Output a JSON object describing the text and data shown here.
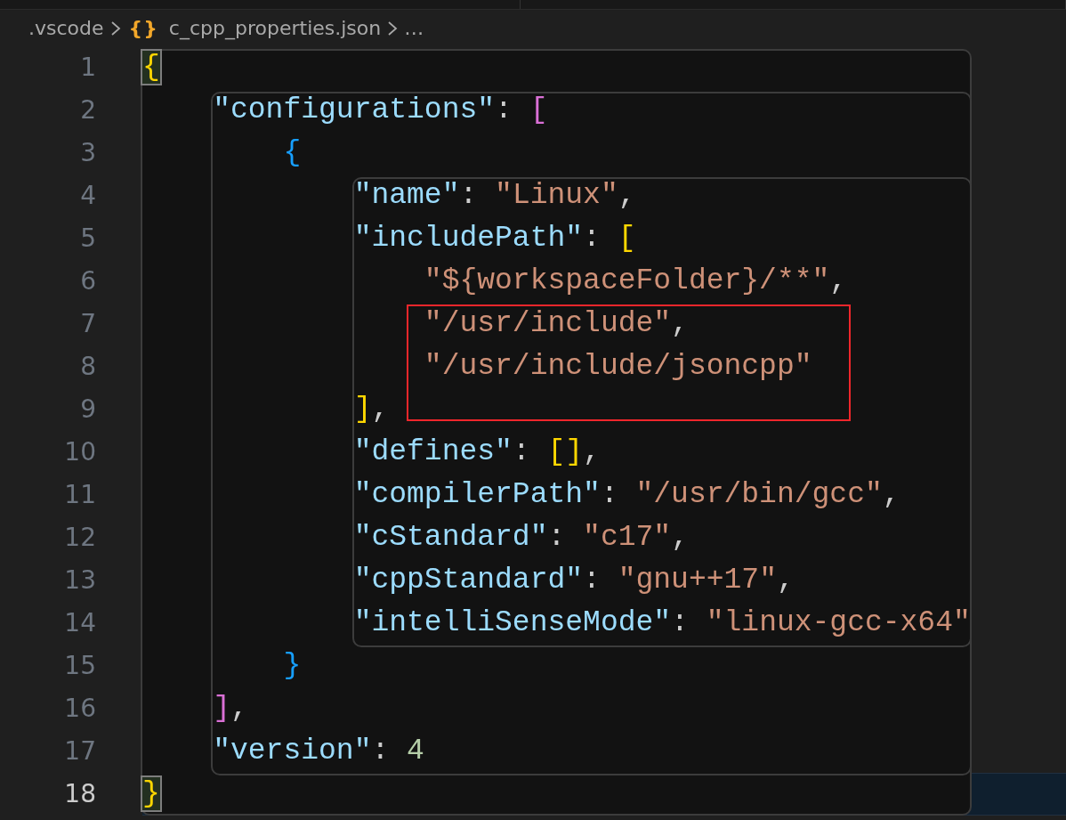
{
  "breadcrumb": {
    "folder": ".vscode",
    "file_icon": "{}",
    "file": "c_cpp_properties.json",
    "more": "…"
  },
  "lines": [
    {
      "number": "1",
      "current": false,
      "annotated": false,
      "tokens": [
        {
          "text": "{",
          "kind": "bracket1",
          "matched": true
        }
      ]
    },
    {
      "number": "2",
      "current": false,
      "annotated": false,
      "tokens": [
        {
          "text": "    \"configurations\"",
          "kind": "key"
        },
        {
          "text": ": ",
          "kind": "punct"
        },
        {
          "text": "[",
          "kind": "bracket2",
          "matched": false
        }
      ]
    },
    {
      "number": "3",
      "current": false,
      "annotated": false,
      "tokens": [
        {
          "text": "        {",
          "kind": "bracket3",
          "matched": false
        }
      ]
    },
    {
      "number": "4",
      "current": false,
      "annotated": false,
      "tokens": [
        {
          "text": "            \"name\"",
          "kind": "key"
        },
        {
          "text": ": ",
          "kind": "punct"
        },
        {
          "text": "\"Linux\"",
          "kind": "string"
        },
        {
          "text": ",",
          "kind": "punct"
        }
      ]
    },
    {
      "number": "5",
      "current": false,
      "annotated": false,
      "tokens": [
        {
          "text": "            \"includePath\"",
          "kind": "key"
        },
        {
          "text": ": ",
          "kind": "punct"
        },
        {
          "text": "[",
          "kind": "bracket1",
          "matched": false
        }
      ]
    },
    {
      "number": "6",
      "current": false,
      "annotated": false,
      "tokens": [
        {
          "text": "                \"${workspaceFolder}/**\"",
          "kind": "string"
        },
        {
          "text": ",",
          "kind": "punct"
        }
      ]
    },
    {
      "number": "7",
      "current": false,
      "annotated": true,
      "tokens": [
        {
          "text": "                \"/usr/include\"",
          "kind": "string"
        },
        {
          "text": ",",
          "kind": "punct"
        }
      ]
    },
    {
      "number": "8",
      "current": false,
      "annotated": true,
      "tokens": [
        {
          "text": "                \"/usr/include/jsoncpp\"",
          "kind": "string"
        }
      ]
    },
    {
      "number": "9",
      "current": false,
      "annotated": true,
      "tokens": [
        {
          "text": "            ]",
          "kind": "bracket1",
          "matched": false
        },
        {
          "text": ",",
          "kind": "punct"
        }
      ]
    },
    {
      "number": "10",
      "current": false,
      "annotated": false,
      "tokens": [
        {
          "text": "            \"defines\"",
          "kind": "key"
        },
        {
          "text": ": ",
          "kind": "punct"
        },
        {
          "text": "[]",
          "kind": "bracket1",
          "matched": false
        },
        {
          "text": ",",
          "kind": "punct"
        }
      ]
    },
    {
      "number": "11",
      "current": false,
      "annotated": false,
      "tokens": [
        {
          "text": "            \"compilerPath\"",
          "kind": "key"
        },
        {
          "text": ": ",
          "kind": "punct"
        },
        {
          "text": "\"/usr/bin/gcc\"",
          "kind": "string"
        },
        {
          "text": ",",
          "kind": "punct"
        }
      ]
    },
    {
      "number": "12",
      "current": false,
      "annotated": false,
      "tokens": [
        {
          "text": "            \"cStandard\"",
          "kind": "key"
        },
        {
          "text": ": ",
          "kind": "punct"
        },
        {
          "text": "\"c17\"",
          "kind": "string"
        },
        {
          "text": ",",
          "kind": "punct"
        }
      ]
    },
    {
      "number": "13",
      "current": false,
      "annotated": false,
      "tokens": [
        {
          "text": "            \"cppStandard\"",
          "kind": "key"
        },
        {
          "text": ": ",
          "kind": "punct"
        },
        {
          "text": "\"gnu++17\"",
          "kind": "string"
        },
        {
          "text": ",",
          "kind": "punct"
        }
      ]
    },
    {
      "number": "14",
      "current": false,
      "annotated": false,
      "tokens": [
        {
          "text": "            \"intelliSenseMode\"",
          "kind": "key"
        },
        {
          "text": ": ",
          "kind": "punct"
        },
        {
          "text": "\"linux-gcc-x64\"",
          "kind": "string"
        }
      ]
    },
    {
      "number": "15",
      "current": false,
      "annotated": false,
      "tokens": [
        {
          "text": "        }",
          "kind": "bracket3",
          "matched": false
        }
      ]
    },
    {
      "number": "16",
      "current": false,
      "annotated": false,
      "tokens": [
        {
          "text": "    ]",
          "kind": "bracket2",
          "matched": false
        },
        {
          "text": ",",
          "kind": "punct"
        }
      ]
    },
    {
      "number": "17",
      "current": false,
      "annotated": false,
      "tokens": [
        {
          "text": "    \"version\"",
          "kind": "key"
        },
        {
          "text": ": ",
          "kind": "punct"
        },
        {
          "text": "4",
          "kind": "number"
        }
      ]
    },
    {
      "number": "18",
      "current": true,
      "annotated": false,
      "tokens": [
        {
          "text": "}",
          "kind": "bracket1",
          "matched": true
        }
      ]
    }
  ]
}
